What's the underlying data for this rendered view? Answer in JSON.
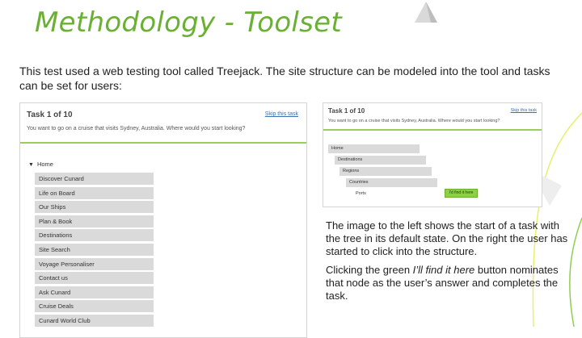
{
  "slide": {
    "title": "Methodology - Toolset",
    "intro": "This test used a web testing tool called Treejack. The site structure can be modeled into the tool and tasks can be set for users:",
    "caption_1": "The image to the left shows the start of a task with the tree in its default state. On the right the user has started to click into the structure.",
    "caption_2_before": "Clicking the green ",
    "caption_2_em": "I’ll find it here",
    "caption_2_after": " button nominates that node as the user’s answer and completes the task."
  },
  "left_shot": {
    "task_title": "Task 1 of 10",
    "skip_label": "Skip this task",
    "task_text": "You want to go on a cruise that visits Sydney, Australia. Where would you start looking?",
    "root_arrow": "▼",
    "root_label": "Home",
    "items": [
      "Discover Cunard",
      "Life on Board",
      "Our Ships",
      "Plan & Book",
      "Destinations",
      "Site Search",
      "Voyage Personaliser",
      "Contact us",
      "Ask Cunard",
      "Cruise Deals",
      "Cunard World Club"
    ]
  },
  "right_shot": {
    "task_title": "Task 1 of 10",
    "skip_label": "Skip this task",
    "task_text": "You want to go on a cruise that visits Sydney, Australia. Where would you start looking?",
    "nodes": [
      "Home",
      "Destinations",
      "Regions",
      "Countries",
      "Ports"
    ],
    "find_button": "I'd find it here"
  },
  "colors": {
    "title_green": "#6ab033",
    "button_green": "#8bd142",
    "accent_line": "#9acd5b"
  }
}
